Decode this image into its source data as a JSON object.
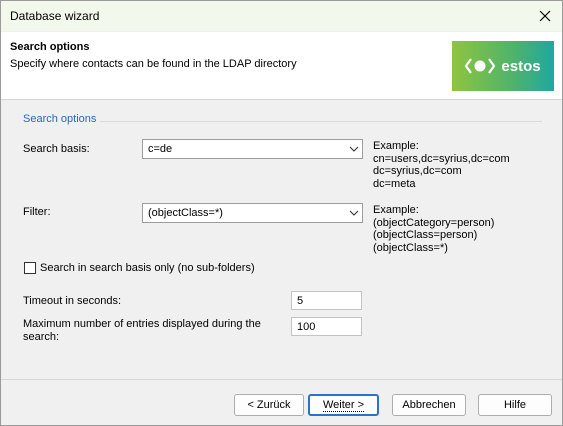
{
  "window": {
    "title": "Database wizard"
  },
  "header": {
    "title": "Search options",
    "subtitle": "Specify where contacts can be found in the LDAP directory",
    "logo_text": "estos"
  },
  "group": {
    "title": "Search options"
  },
  "search_basis": {
    "label": "Search basis:",
    "value": "c=de",
    "example": "Example:\ncn=users,dc=syrius,dc=com\ndc=syrius,dc=com\ndc=meta"
  },
  "filter": {
    "label": "Filter:",
    "value": "(objectClass=*)",
    "example": "Example:\n(objectCategory=person)\n(objectClass=person)\n(objectClass=*)"
  },
  "checkbox": {
    "label": "Search in search basis only (no sub-folders)",
    "checked": false
  },
  "timeout": {
    "label": "Timeout in seconds:",
    "value": "5"
  },
  "max_entries": {
    "label": "Maximum number of entries displayed during the search:",
    "value": "100"
  },
  "buttons": {
    "back": "< Zurück",
    "next": "Weiter >",
    "cancel": "Abbrechen",
    "help": "Hilfe"
  },
  "colors": {
    "accent": "#2b65c4",
    "title_bg": "#f3f8ec",
    "default_button": "#2a73c8"
  }
}
